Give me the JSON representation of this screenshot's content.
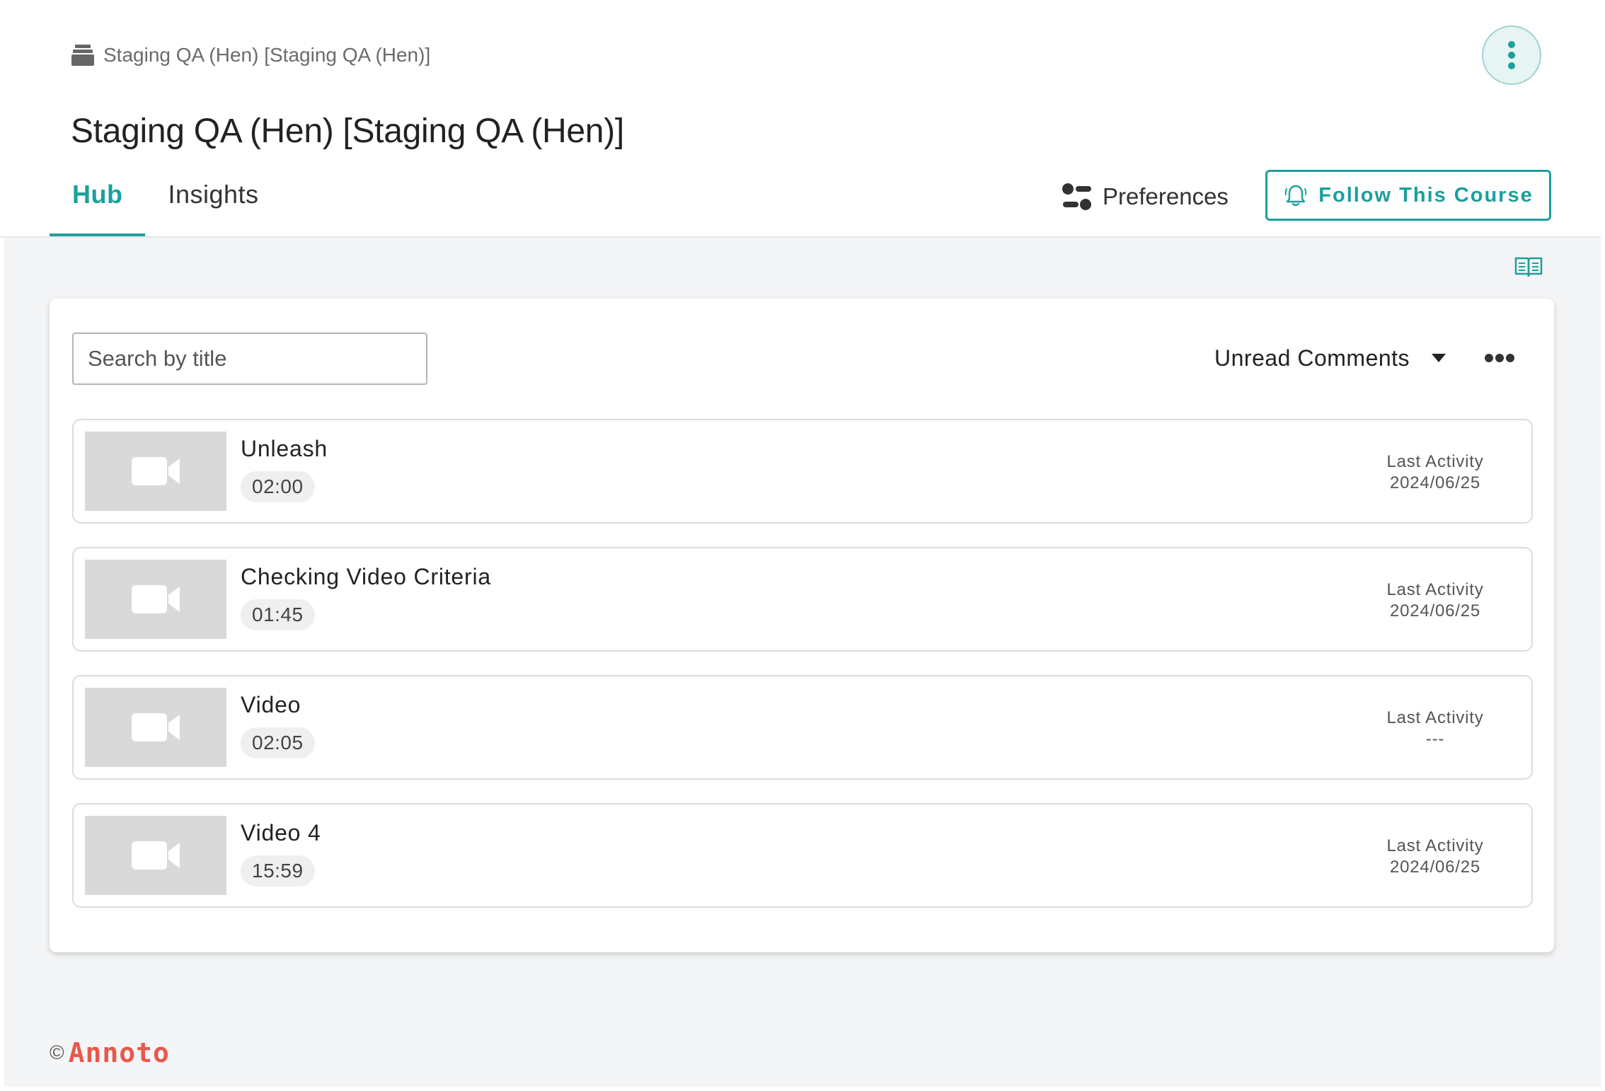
{
  "breadcrumb": {
    "text": "Staging QA (Hen) [Staging QA (Hen)]",
    "icon": "course-stack-icon"
  },
  "page": {
    "title": "Staging QA (Hen) [Staging QA (Hen)]"
  },
  "tabs": [
    {
      "label": "Hub",
      "active": true
    },
    {
      "label": "Insights",
      "active": false
    }
  ],
  "toolbar": {
    "preferences_label": "Preferences",
    "follow_label": "Follow This Course"
  },
  "search": {
    "placeholder": "Search by title",
    "value": ""
  },
  "sort": {
    "label": "Unread Comments"
  },
  "items": [
    {
      "title": "Unleash",
      "duration": "02:00",
      "activity_label": "Last Activity",
      "activity_value": "2024/06/25"
    },
    {
      "title": "Checking Video Criteria",
      "duration": "01:45",
      "activity_label": "Last Activity",
      "activity_value": "2024/06/25"
    },
    {
      "title": "Video",
      "duration": "02:05",
      "activity_label": "Last Activity",
      "activity_value": "---"
    },
    {
      "title": "Video 4",
      "duration": "15:59",
      "activity_label": "Last Activity",
      "activity_value": "2024/06/25"
    }
  ],
  "footer": {
    "copyright": "©",
    "brand": "Annoto"
  },
  "colors": {
    "accent": "#1ba09b",
    "brand": "#e8584b",
    "background": "#f4f5f6",
    "thumbnail": "#d9d9d9"
  }
}
